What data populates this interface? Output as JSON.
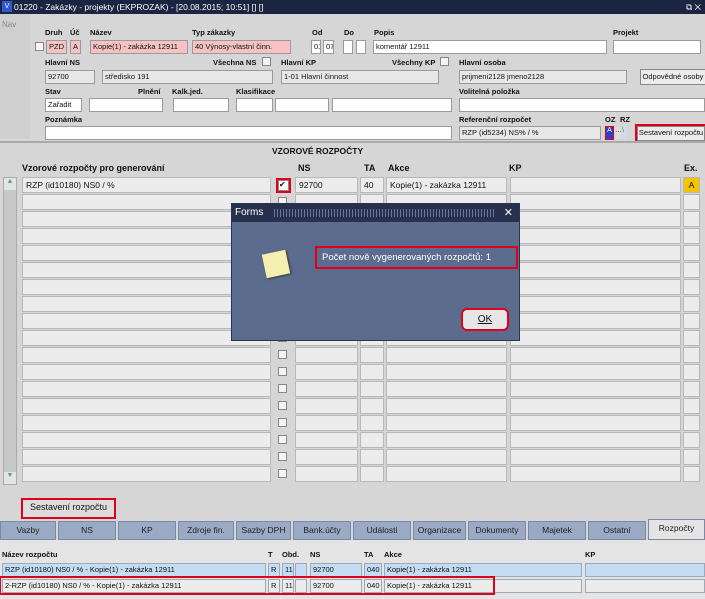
{
  "window": {
    "title": "01220 - Zakázky - projekty (EKPROZAK) - [20.08.2015; 10:51] [] []",
    "nav": "Nav"
  },
  "header": {
    "labels": {
      "druh": "Druh",
      "uc": "Úč",
      "nazev": "Název",
      "typ": "Typ zákazky",
      "od": "Od",
      "do": "Do",
      "popis": "Popis",
      "projekt": "Projekt",
      "hlavni_ns": "Hlavní NS",
      "vsechna_ns": "Všechna NS",
      "hlavni_kp": "Hlavní KP",
      "vsechny_kp": "Všechny KP",
      "hlavni_osoba": "Hlavní osoba",
      "stav": "Stav",
      "plneni": "Plnění",
      "kalk": "Kalk.jed.",
      "klasifikace": "Klasifikace",
      "volitelna": "Volitelná položka",
      "poznamka": "Poznámka",
      "ref": "Referenční rozpočet",
      "oz": "OZ",
      "rz": "RZ"
    },
    "values": {
      "druh": "PZD",
      "uc": "A",
      "nazev": "Kopie(1) - zakázka 12911",
      "typ": "40 Výnosy-vlastní činn.",
      "od1": "01",
      "od2": "07",
      "popis": "komentář 12911",
      "hlavni_ns": "92700",
      "ns_nazev": "středisko 191",
      "hlavni_kp": "1-01 Hlavní činnost",
      "hlavni_osoba": "prijmeni2128 jmeno2128",
      "stav": "Zařadit",
      "ref": "RZP (id5234) NS% / %",
      "oz": "A"
    },
    "buttons": {
      "odpovedne": "Odpovědné osoby",
      "sestaveni": "Sestavení rozpočtu"
    }
  },
  "vzorove": {
    "title": "VZOROVÉ ROZPOČTY",
    "headers": {
      "name": "Vzorové rozpočty pro generování",
      "ns": "NS",
      "ta": "TA",
      "akce": "Akce",
      "kp": "KP",
      "ex": "Ex."
    },
    "rows": [
      {
        "name": "RZP (id10180) NS0 / %",
        "checked": true,
        "ns": "92700",
        "ta": "40",
        "akce": "Kopie(1) - zakázka 12911",
        "kp": "",
        "ex": "A"
      }
    ],
    "button": "Sestavení rozpočtu"
  },
  "dialog": {
    "title": "Forms",
    "message": "Počet nově vygenerovaných rozpočtů: 1",
    "ok": "OK"
  },
  "tabs": [
    "Vazby",
    "NS",
    "KP",
    "Zdroje fin.",
    "Sazby DPH",
    "Bank.účty",
    "Události",
    "Organizace",
    "Dokumenty",
    "Majetek",
    "Ostatní",
    "Rozpočty"
  ],
  "active_tab": "Rozpočty",
  "rozpocty": {
    "headers": {
      "name": "Název rozpočtu",
      "t": "T",
      "obd": "Obd.",
      "ns": "NS",
      "ta": "TA",
      "akce": "Akce",
      "kp": "KP"
    },
    "rows": [
      {
        "name": "RZP (id10180) NS0 / % - Kopie(1) - zakázka 12911",
        "t": "R",
        "obd": "11",
        "ns": "92700",
        "ta": "040",
        "akce": "Kopie(1) - zakázka 12911",
        "kp": ""
      },
      {
        "name": "2-RZP (id10180) NS0 / % - Kopie(1) - zakázka 12911",
        "t": "R",
        "obd": "11",
        "ns": "92700",
        "ta": "040",
        "akce": "Kopie(1) - zakázka 12911",
        "kp": ""
      }
    ]
  }
}
